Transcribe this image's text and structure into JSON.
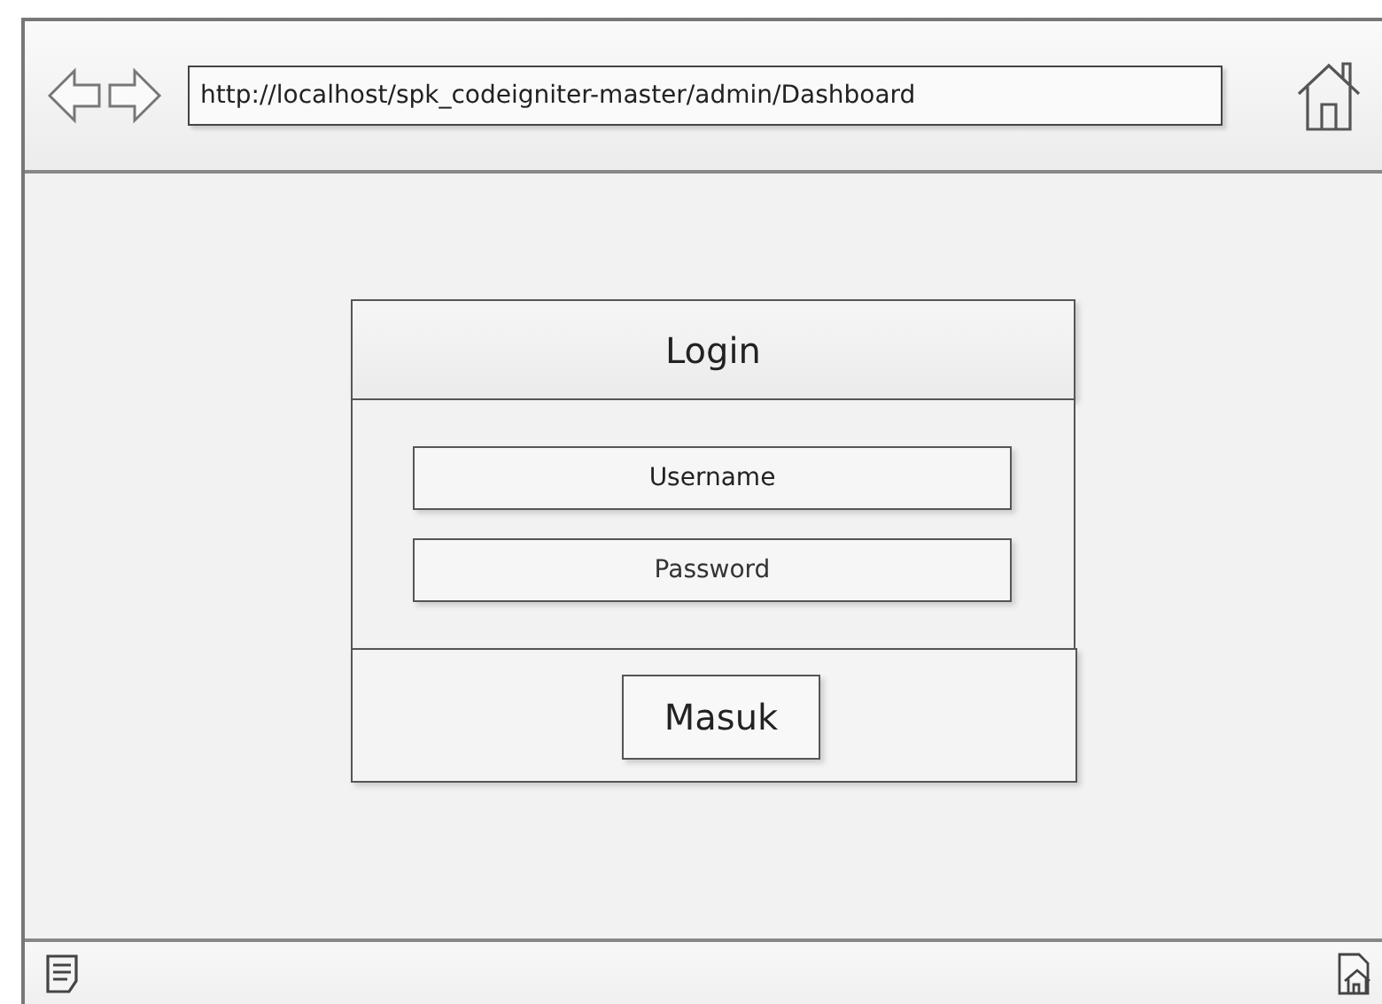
{
  "browser": {
    "address": "http://localhost/spk_codeigniter-master/admin/Dashboard"
  },
  "login": {
    "title": "Login",
    "fields": [
      {
        "placeholder": "Username",
        "kind": "text"
      },
      {
        "placeholder": "Password",
        "kind": "password"
      }
    ],
    "button": "Masuk"
  }
}
